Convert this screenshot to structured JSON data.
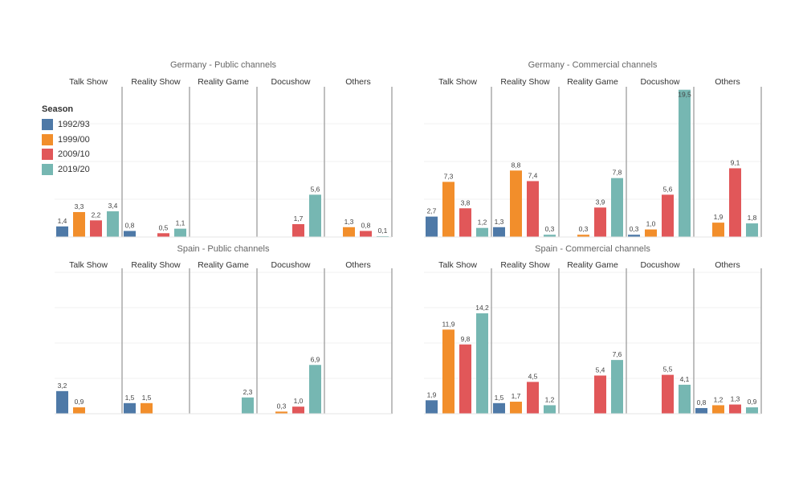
{
  "legend": {
    "title": "Season",
    "items": [
      {
        "label": "1992/93",
        "color": "#4e79a7"
      },
      {
        "label": "1999/00",
        "color": "#f28e2b"
      },
      {
        "label": "2009/10",
        "color": "#e15759"
      },
      {
        "label": "2019/20",
        "color": "#76b7b2"
      }
    ]
  },
  "chart_data": [
    {
      "type": "bar",
      "title": "Germany - Public channels",
      "categories": [
        "Talk Show",
        "Reality Show",
        "Reality Game",
        "Docushow",
        "Others"
      ],
      "series": [
        {
          "name": "1992/93",
          "values": [
            1.4,
            0.8,
            null,
            null,
            null
          ],
          "labels": [
            "1,4",
            "0,8",
            null,
            null,
            null
          ]
        },
        {
          "name": "1999/00",
          "values": [
            3.3,
            null,
            null,
            null,
            1.3
          ],
          "labels": [
            "3,3",
            null,
            null,
            null,
            "1,3"
          ]
        },
        {
          "name": "2009/10",
          "values": [
            2.2,
            0.5,
            null,
            1.7,
            0.8
          ],
          "labels": [
            "2,2",
            "0,5",
            null,
            "1,7",
            "0,8"
          ]
        },
        {
          "name": "2019/20",
          "values": [
            3.4,
            1.1,
            null,
            5.6,
            0.1
          ],
          "labels": [
            "3,4",
            "1,1",
            null,
            "5,6",
            "0,1"
          ]
        }
      ],
      "ylim": [
        0,
        20
      ],
      "grid": true
    },
    {
      "type": "bar",
      "title": "Germany - Commercial channels",
      "categories": [
        "Talk Show",
        "Reality Show",
        "Reality Game",
        "Docushow",
        "Others"
      ],
      "series": [
        {
          "name": "1992/93",
          "values": [
            2.7,
            1.3,
            null,
            0.3,
            null
          ],
          "labels": [
            "2,7",
            "1,3",
            null,
            "0,3",
            null
          ]
        },
        {
          "name": "1999/00",
          "values": [
            7.3,
            8.8,
            0.3,
            1.0,
            1.9
          ],
          "labels": [
            "7,3",
            "8,8",
            "0,3",
            "1,0",
            "1,9"
          ]
        },
        {
          "name": "2009/10",
          "values": [
            3.8,
            7.4,
            3.9,
            5.6,
            9.1
          ],
          "labels": [
            "3,8",
            "7,4",
            "3,9",
            "5,6",
            "9,1"
          ]
        },
        {
          "name": "2019/20",
          "values": [
            1.2,
            0.3,
            7.8,
            19.5,
            1.8
          ],
          "labels": [
            "1,2",
            "0,3",
            "7,8",
            "19,5",
            "1,8"
          ]
        }
      ],
      "ylim": [
        0,
        20
      ],
      "grid": true
    },
    {
      "type": "bar",
      "title": "Spain - Public channels",
      "categories": [
        "Talk Show",
        "Reality Show",
        "Reality Game",
        "Docushow",
        "Others"
      ],
      "series": [
        {
          "name": "1992/93",
          "values": [
            3.2,
            1.5,
            null,
            null,
            null
          ],
          "labels": [
            "3,2",
            "1,5",
            null,
            null,
            null
          ]
        },
        {
          "name": "1999/00",
          "values": [
            0.9,
            1.5,
            null,
            0.3,
            null
          ],
          "labels": [
            "0,9",
            "1,5",
            null,
            "0,3",
            null
          ]
        },
        {
          "name": "2009/10",
          "values": [
            null,
            null,
            null,
            1.0,
            null
          ],
          "labels": [
            null,
            null,
            null,
            "1,0",
            null
          ]
        },
        {
          "name": "2019/20",
          "values": [
            null,
            null,
            2.3,
            6.9,
            null
          ],
          "labels": [
            null,
            null,
            "2,3",
            "6,9",
            null
          ]
        }
      ],
      "ylim": [
        0,
        20
      ],
      "grid": true
    },
    {
      "type": "bar",
      "title": "Spain - Commercial channels",
      "categories": [
        "Talk Show",
        "Reality Show",
        "Reality Game",
        "Docushow",
        "Others"
      ],
      "series": [
        {
          "name": "1992/93",
          "values": [
            1.9,
            1.5,
            null,
            null,
            0.8
          ],
          "labels": [
            "1,9",
            "1,5",
            null,
            null,
            "0,8"
          ]
        },
        {
          "name": "1999/00",
          "values": [
            11.9,
            1.7,
            null,
            null,
            1.2
          ],
          "labels": [
            "11,9",
            "1,7",
            null,
            null,
            "1,2"
          ]
        },
        {
          "name": "2009/10",
          "values": [
            9.8,
            4.5,
            5.4,
            5.5,
            1.3
          ],
          "labels": [
            "9,8",
            "4,5",
            "5,4",
            "5,5",
            "1,3"
          ]
        },
        {
          "name": "2019/20",
          "values": [
            14.2,
            1.2,
            7.6,
            4.1,
            0.9
          ],
          "labels": [
            "14,2",
            "1,2",
            "7,6",
            "4,1",
            "0,9"
          ]
        }
      ],
      "ylim": [
        0,
        20
      ],
      "grid": true
    }
  ]
}
